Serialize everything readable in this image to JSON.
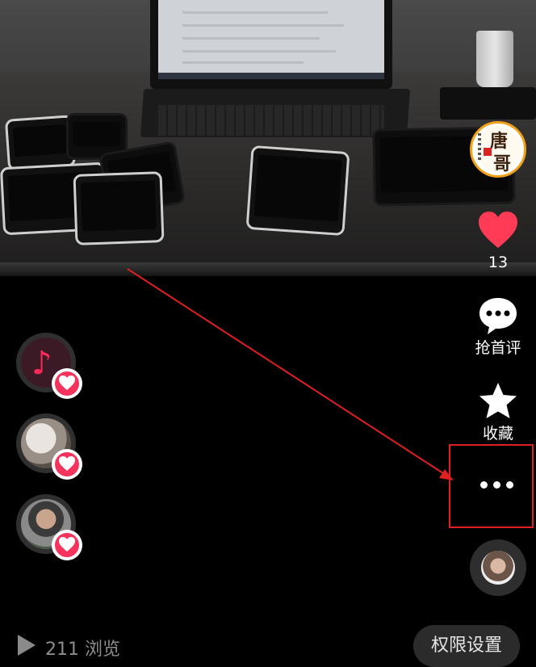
{
  "video": {
    "scene": "photo"
  },
  "actions": {
    "like_count": "13",
    "comment_label": "抢首评",
    "favorite_label": "收藏"
  },
  "bottom": {
    "views_text": "211 浏览",
    "permission_button": "权限设置"
  },
  "colors": {
    "like_heart": "#ff3b55",
    "highlight_box": "#e02020",
    "badge": "#f5335c",
    "avatar_ring": "#f2a21a"
  },
  "icons": [
    "heart-icon",
    "comment-icon",
    "star-icon",
    "more-icon",
    "music-note-icon",
    "play-icon"
  ]
}
